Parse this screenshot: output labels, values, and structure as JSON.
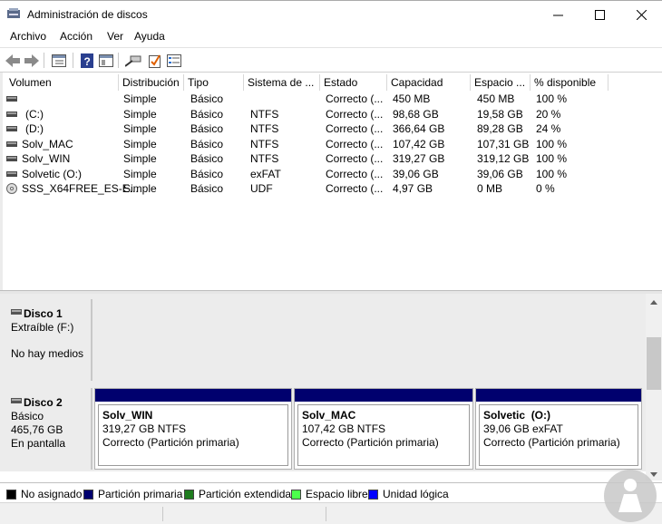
{
  "window": {
    "title": "Administración de discos"
  },
  "menu": [
    "Archivo",
    "Acción",
    "Ver",
    "Ayuda"
  ],
  "toolbar": {
    "icons": [
      "back-arrow-icon",
      "forward-arrow-icon",
      "properties-icon",
      "help-icon",
      "view-icon",
      "connect-icon",
      "check-icon",
      "settings-list-icon"
    ]
  },
  "list": {
    "columns": [
      "Volumen",
      "Distribución",
      "Tipo",
      "Sistema de ...",
      "Estado",
      "Capacidad",
      "Espacio ...",
      "% disponible"
    ],
    "rows": [
      {
        "volume": "",
        "layout": "Simple",
        "type": "Básico",
        "fs": "",
        "status": "Correcto (...",
        "capacity": "450 MB",
        "free": "450 MB",
        "pct": "100 %"
      },
      {
        "volume": "(C:)",
        "layout": "Simple",
        "type": "Básico",
        "fs": "NTFS",
        "status": "Correcto (...",
        "capacity": "98,68 GB",
        "free": "19,58 GB",
        "pct": "20 %"
      },
      {
        "volume": "(D:)",
        "layout": "Simple",
        "type": "Básico",
        "fs": "NTFS",
        "status": "Correcto (...",
        "capacity": "366,64 GB",
        "free": "89,28 GB",
        "pct": "24 %"
      },
      {
        "volume": "Solv_MAC",
        "layout": "Simple",
        "type": "Básico",
        "fs": "NTFS",
        "status": "Correcto (...",
        "capacity": "107,42 GB",
        "free": "107,31 GB",
        "pct": "100 %"
      },
      {
        "volume": "Solv_WIN",
        "layout": "Simple",
        "type": "Básico",
        "fs": "NTFS",
        "status": "Correcto (...",
        "capacity": "319,27 GB",
        "free": "319,12 GB",
        "pct": "100 %"
      },
      {
        "volume": "Solvetic (O:)",
        "layout": "Simple",
        "type": "Básico",
        "fs": "exFAT",
        "status": "Correcto (...",
        "capacity": "39,06 GB",
        "free": "39,06 GB",
        "pct": "100 %"
      },
      {
        "volume": "SSS_X64FREE_ES-E...",
        "layout": "Simple",
        "type": "Básico",
        "fs": "UDF",
        "status": "Correcto (...",
        "capacity": "4,97 GB",
        "free": "0 MB",
        "pct": "0 %"
      }
    ]
  },
  "disks": {
    "disk1": {
      "name": "Disco 1",
      "kind": "Extraíble (F:)",
      "media": "No hay medios"
    },
    "disk2": {
      "name": "Disco 2",
      "kind": "Básico",
      "size": "465,76 GB",
      "state": "En pantalla",
      "partitions": [
        {
          "name": "Solv_WIN",
          "size": "319,27 GB NTFS",
          "status": "Correcto (Partición primaria)"
        },
        {
          "name": "Solv_MAC",
          "size": "107,42 GB NTFS",
          "status": "Correcto (Partición primaria)"
        },
        {
          "name": "Solvetic  (O:)",
          "size": "39,06 GB exFAT",
          "status": "Correcto (Partición primaria)"
        }
      ]
    }
  },
  "legend": [
    {
      "label": "No asignado",
      "color": "#000000"
    },
    {
      "label": "Partición primaria",
      "color": "#00006e"
    },
    {
      "label": "Partición extendida",
      "color": "#1e7c1e"
    },
    {
      "label": "Espacio libre",
      "color": "#4cff4c"
    },
    {
      "label": "Unidad lógica",
      "color": "#0000ff"
    }
  ],
  "colors": {
    "primary_partition_bar": "#00006e",
    "pane_bg": "#ececec"
  }
}
